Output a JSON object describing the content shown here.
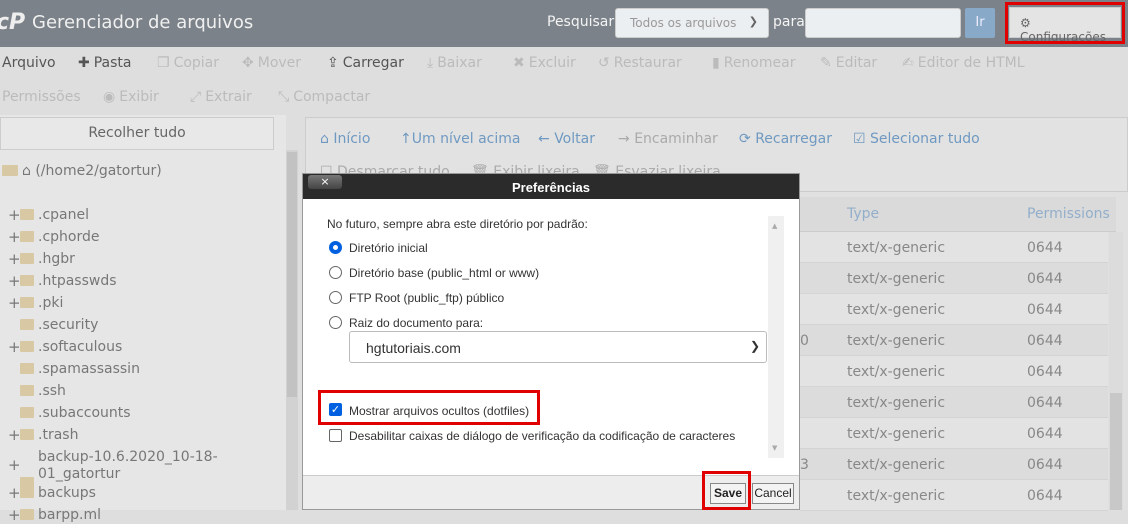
{
  "header": {
    "logo": "cP",
    "title": "Gerenciador de arquivos",
    "search_label": "Pesquisar",
    "search_scope": "Todos os arquivos",
    "para": "para",
    "search_value": "",
    "go": "Ir",
    "settings": "Configurações"
  },
  "toolbar": {
    "row1": [
      {
        "label": "Arquivo",
        "icon": "plus-icon",
        "enabled": true
      },
      {
        "label": "Pasta",
        "icon": "plus-icon",
        "enabled": true
      },
      {
        "label": "Copiar",
        "icon": "copy-icon",
        "enabled": false
      },
      {
        "label": "Mover",
        "icon": "move-icon",
        "enabled": false
      },
      {
        "label": "Carregar",
        "icon": "upload-icon",
        "enabled": true
      },
      {
        "label": "Baixar",
        "icon": "download-icon",
        "enabled": false
      },
      {
        "label": "Excluir",
        "icon": "x-icon",
        "enabled": false
      },
      {
        "label": "Restaurar",
        "icon": "undo-icon",
        "enabled": false
      },
      {
        "label": "Renomear",
        "icon": "file-icon",
        "enabled": false
      },
      {
        "label": "Editar",
        "icon": "pencil-icon",
        "enabled": false
      },
      {
        "label": "Editor de HTML",
        "icon": "edit-icon",
        "enabled": false
      }
    ],
    "row2": [
      {
        "label": "Permissões",
        "enabled": false
      },
      {
        "label": "Exibir",
        "icon": "eye-icon",
        "enabled": false
      },
      {
        "label": "Extrair",
        "icon": "expand-icon",
        "enabled": false
      },
      {
        "label": "Compactar",
        "icon": "compress-icon",
        "enabled": false
      }
    ]
  },
  "sidebar": {
    "collapse": "Recolher tudo",
    "root": "(/home2/gatortur)",
    "items": [
      {
        "name": ".cpanel",
        "expandable": true
      },
      {
        "name": ".cphorde",
        "expandable": true
      },
      {
        "name": ".hgbr",
        "expandable": true
      },
      {
        "name": ".htpasswds",
        "expandable": true
      },
      {
        "name": ".pki",
        "expandable": true
      },
      {
        "name": ".security",
        "expandable": false
      },
      {
        "name": ".softaculous",
        "expandable": true
      },
      {
        "name": ".spamassassin",
        "expandable": false
      },
      {
        "name": ".ssh",
        "expandable": false
      },
      {
        "name": ".subaccounts",
        "expandable": false
      },
      {
        "name": ".trash",
        "expandable": true
      },
      {
        "name": "backup-10.6.2020_10-18-",
        "name2": "01_gatortur",
        "expandable": true
      },
      {
        "name": "backups",
        "expandable": true
      },
      {
        "name": "barpp.ml",
        "expandable": true
      }
    ]
  },
  "nav": {
    "home": "Início",
    "up": "Um nível acima",
    "back": "Voltar",
    "forward": "Encaminhar",
    "reload": "Recarregar",
    "select_all": "Selecionar tudo",
    "deselect_all": "Desmarcar tudo",
    "view_trash": "Exibir lixeira",
    "empty_trash": "Esvaziar lixeira"
  },
  "table": {
    "columns": [
      "Type",
      "Permissions"
    ],
    "rows": [
      {
        "size": "",
        "type": "text/x-generic",
        "perm": "0644"
      },
      {
        "size": "",
        "type": "text/x-generic",
        "perm": "0644"
      },
      {
        "size": "",
        "type": "text/x-generic",
        "perm": "0644"
      },
      {
        "size": "0",
        "type": "text/x-generic",
        "perm": "0644"
      },
      {
        "size": "",
        "type": "text/x-generic",
        "perm": "0644"
      },
      {
        "size": "",
        "type": "text/x-generic",
        "perm": "0644"
      },
      {
        "size": "",
        "type": "text/x-generic",
        "perm": "0644"
      },
      {
        "size": "3",
        "type": "text/x-generic",
        "perm": "0644"
      },
      {
        "size": "",
        "type": "text/x-generic",
        "perm": "0644"
      }
    ]
  },
  "dialog": {
    "title": "Preferências",
    "close": "×",
    "prompt": "No futuro, sempre abra este diretório por padrão:",
    "options": [
      {
        "label": "Diretório inicial",
        "selected": true
      },
      {
        "label": "Diretório base (public_html or www)",
        "selected": false
      },
      {
        "label": "FTP Root (public_ftp) público",
        "selected": false
      },
      {
        "label": "Raiz do documento para:",
        "selected": false
      }
    ],
    "docroot": "hgtutoriais.com",
    "show_hidden": {
      "label": "Mostrar arquivos ocultos (dotfiles)",
      "checked": true
    },
    "disable_encoding": {
      "label": "Desabilitar caixas de diálogo de verificação da codificação de caracteres",
      "checked": false
    },
    "save": "Save",
    "cancel": "Cancel"
  },
  "colors": {
    "highlight": "#e00000",
    "accent": "#6f99c1",
    "checkbox": "#0060df"
  }
}
